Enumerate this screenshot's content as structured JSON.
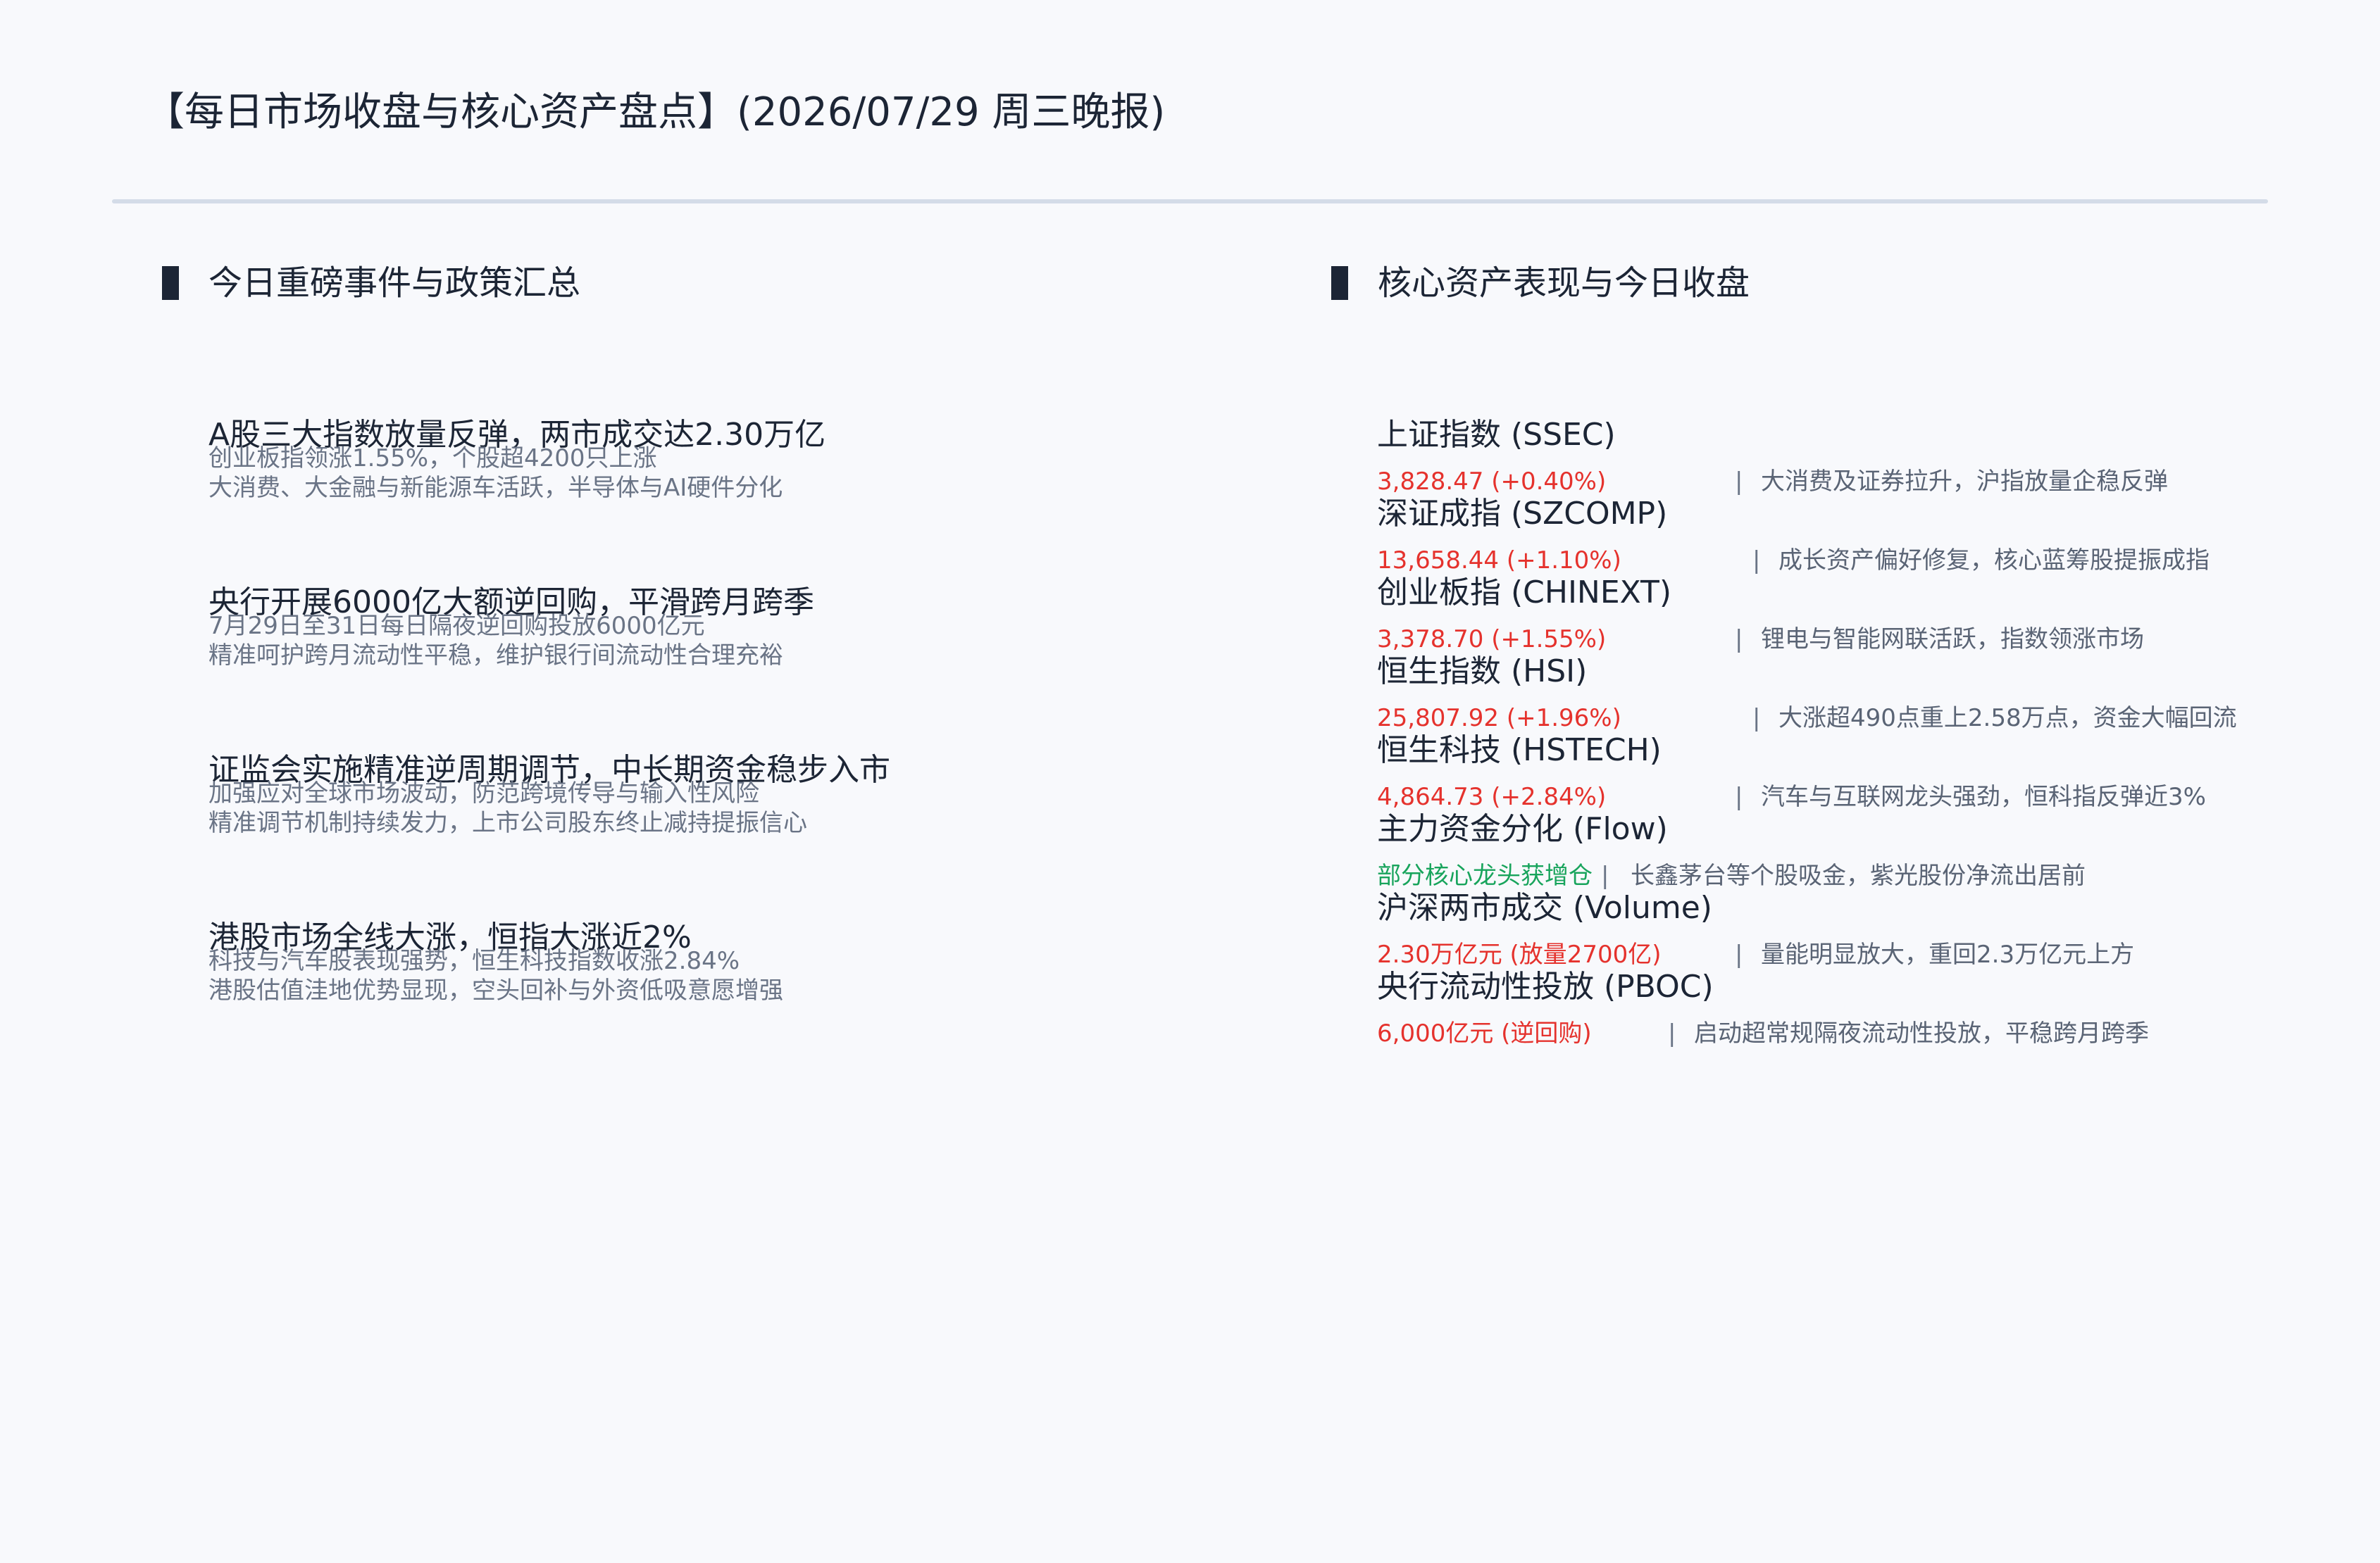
{
  "header": {
    "title": "【每日市场收盘与核心资产盘点】(2026/07/29 周三晚报)"
  },
  "colors": {
    "up": "#e5322d",
    "flow": "#18a45c",
    "rule": "#d4dce8",
    "text": "#1c2535",
    "muted": "#6a7486"
  },
  "left_section": {
    "title": "今日重磅事件与政策汇总",
    "events": [
      {
        "title": "A股三大指数放量反弹，两市成交达2.30万亿",
        "line1": "创业板指领涨1.55%，个股超4200只上涨",
        "line2": "大消费、大金融与新能源车活跃，半导体与AI硬件分化"
      },
      {
        "title": "央行开展6000亿大额逆回购，平滑跨月跨季",
        "line1": "7月29日至31日每日隔夜逆回购投放6000亿元",
        "line2": "精准呵护跨月流动性平稳，维护银行间流动性合理充裕"
      },
      {
        "title": "证监会实施精准逆周期调节，中长期资金稳步入市",
        "line1": "加强应对全球市场波动，防范跨境传导与输入性风险",
        "line2": "精准调节机制持续发力，上市公司股东终止减持提振信心"
      },
      {
        "title": "港股市场全线大涨，恒指大涨近2%",
        "line1": "科技与汽车股表现强势，恒生科技指数收涨2.84%",
        "line2": "港股估值洼地优势显现，空头回补与外资低吸意愿增强"
      }
    ]
  },
  "right_section": {
    "title": "核心资产表现与今日收盘",
    "separator": "|",
    "assets": [
      {
        "name": "上证指数 (SSEC)",
        "value": "3,828.47 (+0.40%)",
        "tone": "red",
        "note": "大消费及证券拉升，沪指放量企稳反弹"
      },
      {
        "name": "深证成指 (SZCOMP)",
        "value": "13,658.44 (+1.10%)",
        "tone": "red",
        "note": "成长资产偏好修复，核心蓝筹股提振成指"
      },
      {
        "name": "创业板指 (CHINEXT)",
        "value": "3,378.70 (+1.55%)",
        "tone": "red",
        "note": "锂电与智能网联活跃，指数领涨市场"
      },
      {
        "name": "恒生指数 (HSI)",
        "value": "25,807.92 (+1.96%)",
        "tone": "red",
        "note": "大涨超490点重上2.58万点，资金大幅回流"
      },
      {
        "name": "恒生科技 (HSTECH)",
        "value": "4,864.73 (+2.84%)",
        "tone": "red",
        "note": "汽车与互联网龙头强劲，恒科指反弹近3%"
      },
      {
        "name": "主力资金分化 (Flow)",
        "value": "部分核心龙头获增仓",
        "tone": "green",
        "note": "长鑫茅台等个股吸金，紫光股份净流出居前"
      },
      {
        "name": "沪深两市成交 (Volume)",
        "value": "2.30万亿元 (放量2700亿)",
        "tone": "red",
        "note": "量能明显放大，重回2.3万亿元上方"
      },
      {
        "name": "央行流动性投放 (PBOC)",
        "value": "6,000亿元 (逆回购)",
        "tone": "red",
        "note": "启动超常规隔夜流动性投放，平稳跨月跨季"
      }
    ]
  }
}
